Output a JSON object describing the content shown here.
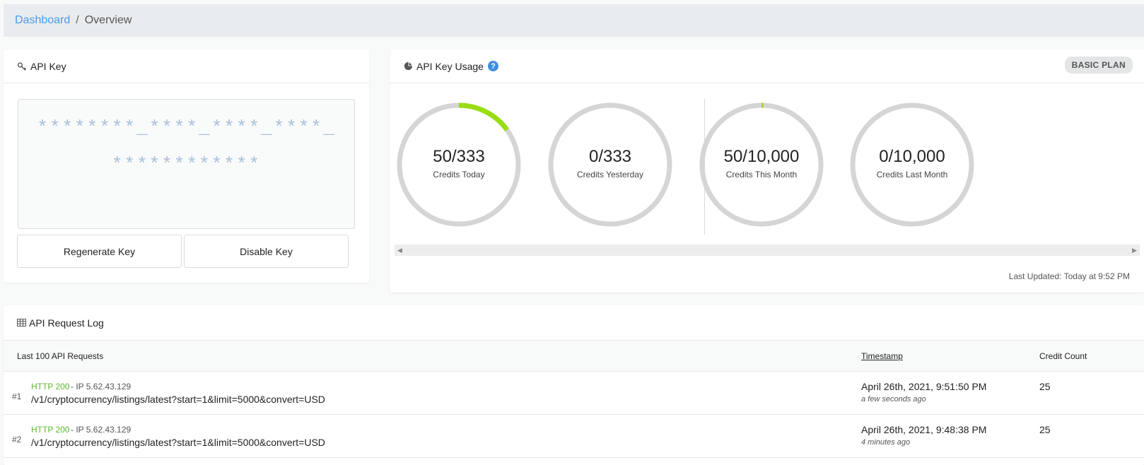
{
  "breadcrumb": {
    "link": "Dashboard",
    "separator": "/",
    "current": "Overview"
  },
  "api_key": {
    "title": "API Key",
    "masked_line1": "********_****_****_****_",
    "masked_line2": "************",
    "regenerate_label": "Regenerate Key",
    "disable_label": "Disable Key"
  },
  "usage": {
    "title": "API Key Usage",
    "help": "?",
    "plan": "BASIC PLAN",
    "updated": "Last Updated: Today at 9:52 PM",
    "accent": "#99dd11",
    "track": "#d5d5d5",
    "gauges": [
      {
        "value": "50/333",
        "label": "Credits Today",
        "fraction": 0.15
      },
      {
        "value": "0/333",
        "label": "Credits Yesterday",
        "fraction": 0
      },
      {
        "value": "50/10,000",
        "label": "Credits This Month",
        "fraction": 0.005
      },
      {
        "value": "0/10,000",
        "label": "Credits Last Month",
        "fraction": 0
      }
    ]
  },
  "log": {
    "title": "API Request Log",
    "col_requests": "Last 100 API Requests",
    "col_timestamp": "Timestamp",
    "col_credit": "Credit Count",
    "rows": [
      {
        "num": "#1",
        "status": "HTTP 200",
        "ip": "- IP 5.62.43.129",
        "path": "/v1/cryptocurrency/listings/latest?start=1&limit=5000&convert=USD",
        "timestamp": "April 26th, 2021, 9:51:50 PM",
        "ago": "a few seconds ago",
        "credits": "25"
      },
      {
        "num": "#2",
        "status": "HTTP 200",
        "ip": "- IP 5.62.43.129",
        "path": "/v1/cryptocurrency/listings/latest?start=1&limit=5000&convert=USD",
        "timestamp": "April 26th, 2021, 9:48:38 PM",
        "ago": "4 minutes ago",
        "credits": "25"
      }
    ]
  }
}
